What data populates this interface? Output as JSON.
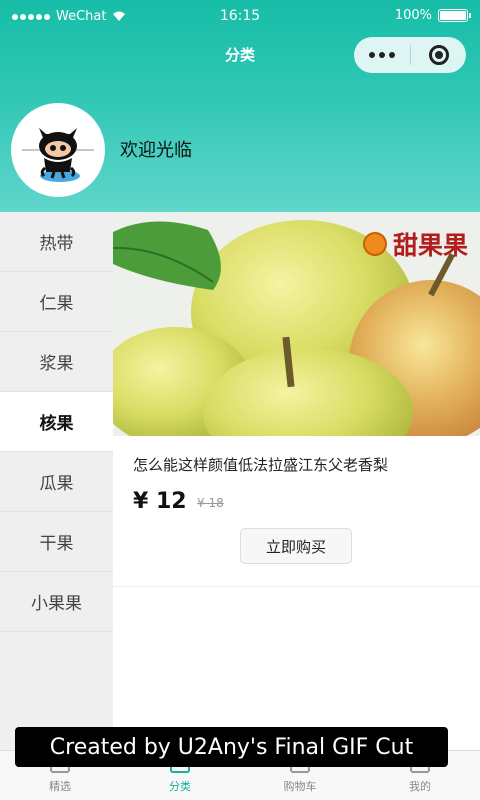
{
  "status_bar": {
    "carrier": "WeChat",
    "time": "16:15",
    "battery": "100%"
  },
  "nav": {
    "title": "分类"
  },
  "profile": {
    "welcome": "欢迎光临"
  },
  "categories": [
    {
      "label": "热带",
      "active": false
    },
    {
      "label": "仁果",
      "active": false
    },
    {
      "label": "浆果",
      "active": false
    },
    {
      "label": "核果",
      "active": true
    },
    {
      "label": "瓜果",
      "active": false
    },
    {
      "label": "干果",
      "active": false
    },
    {
      "label": "小果果",
      "active": false
    }
  ],
  "product": {
    "brand": "甜果果",
    "title": "怎么能这样颜值低法拉盛江东父老香梨",
    "price": "¥ 12",
    "old_price": "¥ 18",
    "buy_label": "立即购买"
  },
  "tabbar": [
    {
      "label": "精选",
      "icon": "home-icon",
      "active": false
    },
    {
      "label": "分类",
      "icon": "category-icon",
      "active": true
    },
    {
      "label": "购物车",
      "icon": "cart-icon",
      "active": false
    },
    {
      "label": "我的",
      "icon": "user-icon",
      "active": false
    }
  ],
  "watermark": "Created by U2Any's Final GIF Cut",
  "colors": {
    "accent": "#1aad9f",
    "header_top": "#17bda7",
    "header_bottom": "#5fd6cb"
  }
}
